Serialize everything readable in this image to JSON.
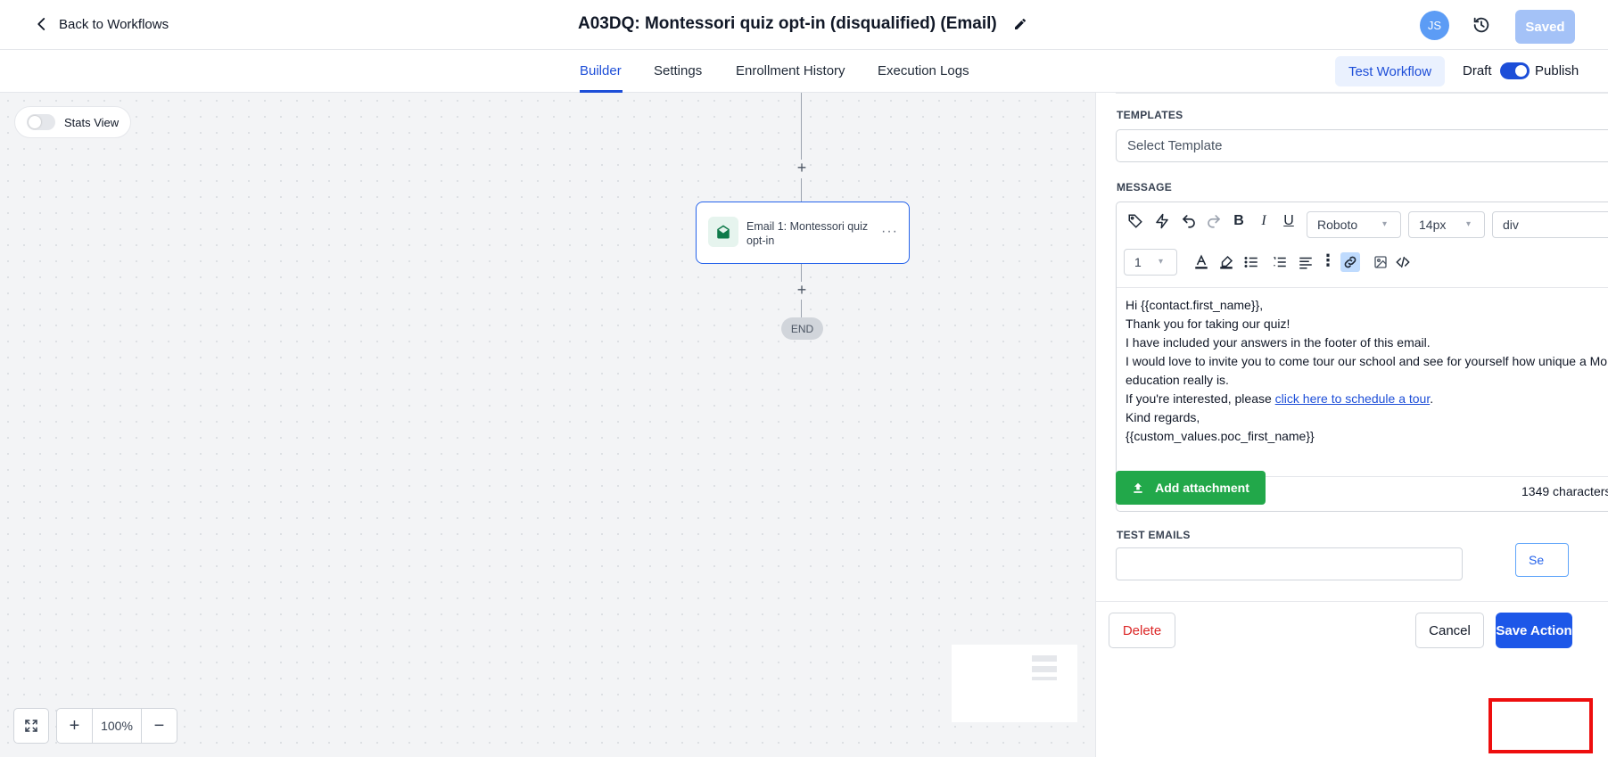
{
  "header": {
    "back_label": "Back to Workflows",
    "title": "A03DQ: Montessori quiz opt-in (disqualified) (Email)",
    "avatar_initials": "JS",
    "saved_label": "Saved"
  },
  "tabs": [
    {
      "label": "Builder",
      "active": true
    },
    {
      "label": "Settings",
      "active": false
    },
    {
      "label": "Enrollment History",
      "active": false
    },
    {
      "label": "Execution Logs",
      "active": false
    }
  ],
  "toolbar": {
    "test_workflow_label": "Test Workflow",
    "draft_label": "Draft",
    "publish_label": "Publish",
    "publish_toggle_on": true
  },
  "canvas": {
    "stats_view_label": "Stats View",
    "node_label": "Email 1: Montessori quiz opt-in",
    "end_label": "END",
    "zoom_value": "100%"
  },
  "panel": {
    "templates_label": "TEMPLATES",
    "template_placeholder": "Select Template",
    "message_label": "MESSAGE",
    "font_family": "Roboto",
    "font_size": "14px",
    "block_type": "div",
    "line_height": "1",
    "message_lines": [
      "Hi {{contact.first_name}},",
      "Thank you for taking our quiz!",
      "I have included your answers in the footer of this email.",
      "I would love to invite you to come tour our school and see for yourself how unique a Mon",
      "education really is."
    ],
    "interest_prefix": "If you're interested, please ",
    "interest_link": "click here to schedule a tour",
    "interest_suffix": ".",
    "signoff_lines": [
      "Kind regards,",
      "{{custom_values.poc_first_name}}"
    ],
    "char_count": "1349 characters",
    "attach_label": "Add attachment",
    "test_emails_label": "TEST EMAILS",
    "test_email_value": "",
    "send_label": "Se",
    "delete_label": "Delete",
    "cancel_label": "Cancel",
    "save_label": "Save Action"
  },
  "colors": {
    "primary": "#1d57e8",
    "success": "#22a84a",
    "danger": "#dc2626",
    "highlight_outline": "#ee0e0e"
  }
}
